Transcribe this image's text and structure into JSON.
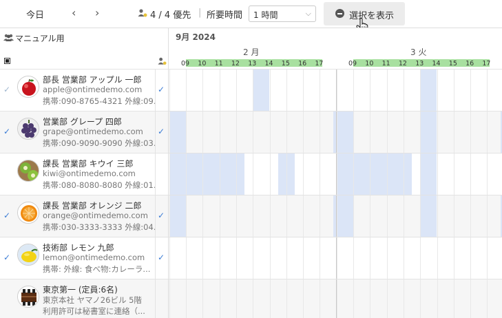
{
  "toolbar": {
    "today_label": "今日",
    "prev_label": "‹",
    "next_label": "›",
    "priority_label": "4 / 4 優先",
    "separator": "|",
    "duration_label": "所要時間",
    "duration_value": "1 時間",
    "show_selection_label": "選択を表示"
  },
  "left_header": {
    "group_name": "マニュアル用"
  },
  "calendar": {
    "month_label": "9月 2024",
    "days": [
      {
        "label": "2 月",
        "hours": [
          "09",
          "10",
          "11",
          "12",
          "13",
          "14",
          "15",
          "16",
          "17"
        ]
      },
      {
        "label": "3 火",
        "hours": [
          "09",
          "10",
          "11",
          "12",
          "13",
          "14",
          "15",
          "16",
          "17"
        ]
      }
    ]
  },
  "rows": [
    {
      "name": "部長 営業部 アップル 一郎",
      "email": "apple@ontimedemo.com",
      "phone": "携帯:090-8765-4321 外線:09...",
      "avatar": "apple-avatar",
      "selected": false,
      "priority": true
    },
    {
      "name": "営業部 グレープ 四郎",
      "email": "grape@ontimedemo.com",
      "phone": "携帯:090-9090-9090 外線:03...",
      "avatar": "grape-avatar",
      "selected": true,
      "priority": true
    },
    {
      "name": "課長 営業部 キウイ 三郎",
      "email": "kiwi@ontimedemo.com",
      "phone": "携帯:080-8080-8080 外線:01...",
      "avatar": "kiwi-avatar",
      "selected": false,
      "priority": false
    },
    {
      "name": "課長 営業部 オレンジ 二郎",
      "email": "orange@ontimedemo.com",
      "phone": "携帯:030-3333-3333 外線:04...",
      "avatar": "orange-avatar",
      "selected": true,
      "priority": true
    },
    {
      "name": "技術部 レモン 九郎",
      "email": "lemon@ontimedemo.com",
      "phone": "携帯: 外線: 食べ物:カレーラ...",
      "avatar": "lemon-avatar",
      "selected": true,
      "priority": true
    },
    {
      "name": "東京第一 (定員:6名)",
      "email": "東京本社 ヤマノ26ビル 5階",
      "phone": "利用許可は秘書室に連絡（...",
      "avatar": "room-avatar",
      "selected": false,
      "priority": false
    }
  ],
  "colors": {
    "accent": "#3a7bd5",
    "busy": "#dbe5f7",
    "work_hours": "#a8e0a0"
  }
}
